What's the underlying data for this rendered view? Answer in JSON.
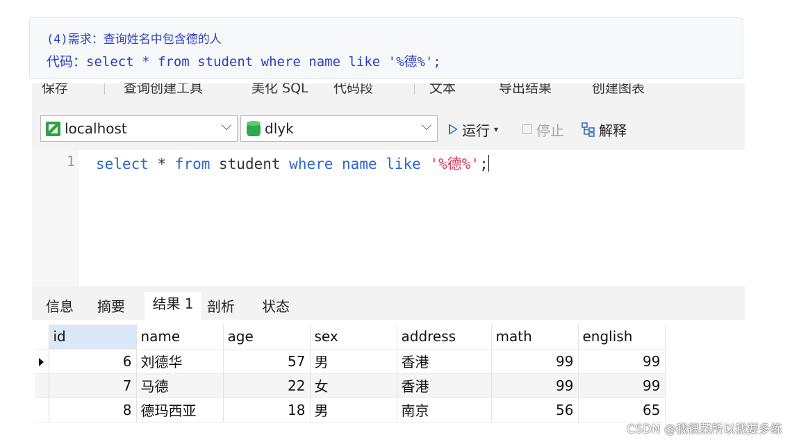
{
  "note": {
    "line1": "(4)需求：查询姓名中包含德的人",
    "line2": "代码：select * from student where name like '%德%';"
  },
  "toolbar_top": {
    "items": [
      "保存",
      "查询创建工具",
      "美化 SQL",
      "代码段",
      "文本",
      "导出结果",
      "创建图表"
    ]
  },
  "toolbar": {
    "connection": "localhost",
    "database": "dlyk",
    "run_label": "运行",
    "stop_label": "停止",
    "explain_label": "解释"
  },
  "editor": {
    "line_number": "1",
    "tokens": {
      "select": "select",
      "star": " * ",
      "from": "from",
      "table": " student ",
      "where": "where",
      "col": " name ",
      "like": "like",
      "pattern": "'%德%'",
      "semicolon": ";"
    }
  },
  "result_tabs": [
    "信息",
    "摘要",
    "结果 1",
    "剖析",
    "状态"
  ],
  "active_tab": "结果 1",
  "table": {
    "columns": [
      "id",
      "name",
      "age",
      "sex",
      "address",
      "math",
      "english"
    ],
    "rows": [
      {
        "id": "6",
        "name": "刘德华",
        "age": "57",
        "sex": "男",
        "address": "香港",
        "math": "99",
        "english": "99"
      },
      {
        "id": "7",
        "name": "马德",
        "age": "22",
        "sex": "女",
        "address": "香港",
        "math": "99",
        "english": "99"
      },
      {
        "id": "8",
        "name": "德玛西亚",
        "age": "18",
        "sex": "男",
        "address": "南京",
        "math": "56",
        "english": "65"
      }
    ]
  },
  "watermark": "CSDN @我很菜所以我要多练"
}
